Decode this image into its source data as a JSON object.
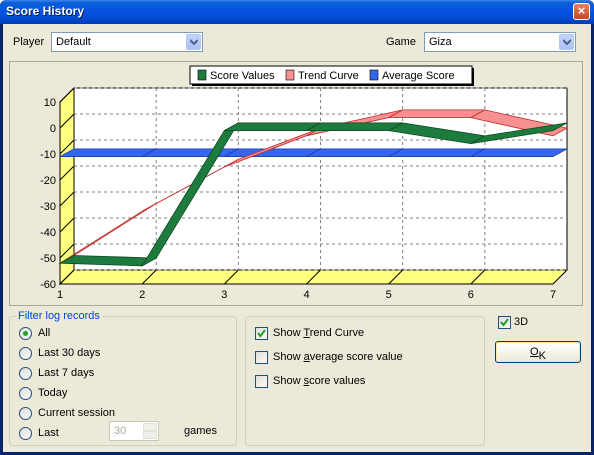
{
  "window": {
    "title": "Score History"
  },
  "player": {
    "label": "Player",
    "value": "Default"
  },
  "game": {
    "label": "Game",
    "value": "Giza"
  },
  "colors": {
    "score": "#1e7b3e",
    "trend": "#f79090",
    "average": "#3567ee",
    "floor": "#ffff80"
  },
  "legend": [
    {
      "label": "Score Values",
      "color": "#1e7b3e",
      "icon": "green-square"
    },
    {
      "label": "Trend Curve",
      "color": "#f79090",
      "icon": "pink-square"
    },
    {
      "label": "Average Score",
      "color": "#3567ee",
      "icon": "blue-square"
    }
  ],
  "chart_data": {
    "type": "line",
    "three_d": true,
    "x": [
      1,
      2,
      3,
      4,
      5,
      6,
      7
    ],
    "xticks": [
      "1",
      "2",
      "3",
      "4",
      "5",
      "6",
      "7"
    ],
    "yticks": [
      "10",
      "0",
      "-10",
      "-20",
      "-30",
      "-40",
      "-50",
      "-60"
    ],
    "ylim": [
      -60,
      10
    ],
    "grid": true,
    "legend_position": "top",
    "series": [
      {
        "name": "Score Values",
        "values": [
          -52,
          -53,
          -1,
          -1,
          -1,
          -6,
          -1
        ]
      },
      {
        "name": "Trend Curve",
        "values": [
          -52,
          -32,
          -15,
          -3,
          4,
          4,
          -3
        ]
      },
      {
        "name": "Average Score",
        "values": [
          -11,
          -11,
          -11,
          -11,
          -11,
          -11,
          -11
        ]
      }
    ]
  },
  "filter": {
    "title": "Filter log records",
    "options": [
      "All",
      "Last 30 days",
      "Last 7 days",
      "Today",
      "Current session",
      "Last"
    ],
    "selected": 0,
    "games_value": "30",
    "games_suffix": "games"
  },
  "options": {
    "trend": {
      "pre": "Show ",
      "u": "T",
      "post": "rend Curve",
      "checked": true
    },
    "average": {
      "pre": "Show ",
      "u": "a",
      "post": "verage score value",
      "checked": false
    },
    "score": {
      "pre": "Show ",
      "u": "s",
      "post": "core values",
      "checked": false
    }
  },
  "three_d": {
    "label": "3D",
    "checked": true
  },
  "ok": {
    "u": "O",
    "post": "K"
  }
}
